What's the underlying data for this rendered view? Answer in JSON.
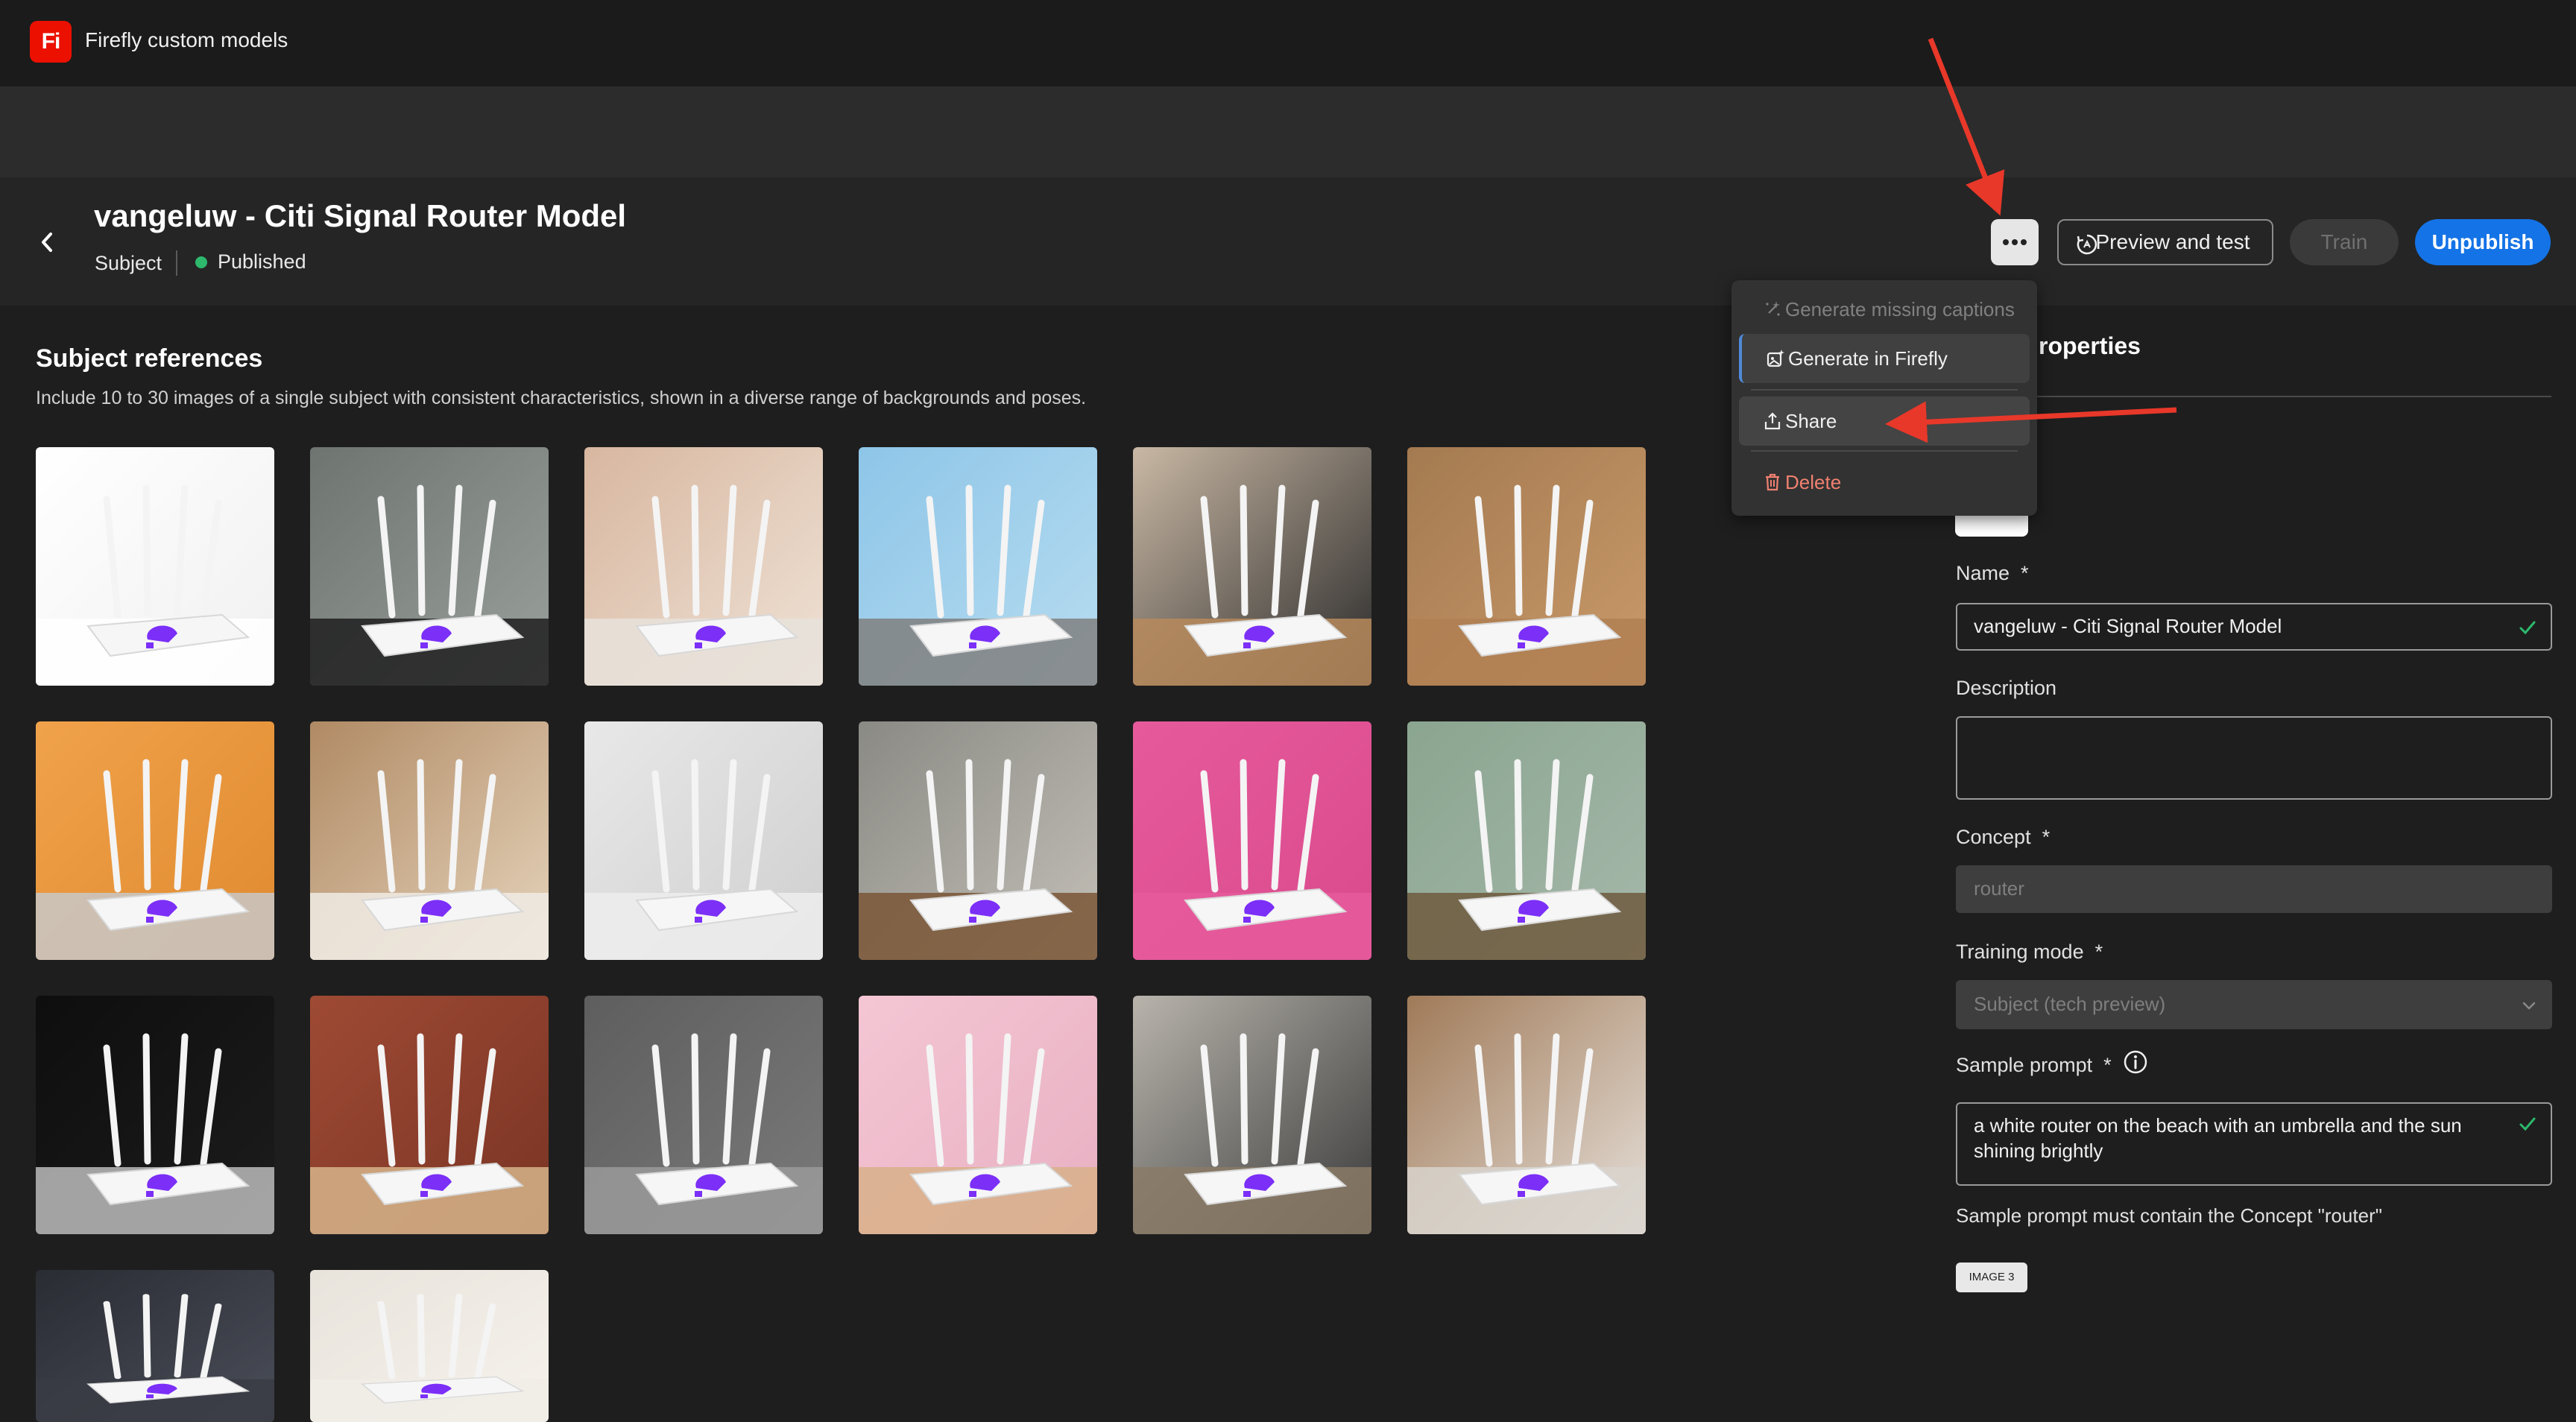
{
  "app": {
    "title": "Firefly custom models",
    "logo_text": "Fi",
    "brand_color": "#eb1000"
  },
  "header": {
    "title": "vangeluw - Citi Signal Router Model",
    "type": "Subject",
    "status": "Published",
    "status_color": "#2db86c",
    "preview_label": "Preview and test",
    "train_label": "Train",
    "unpublish_label": "Unpublish",
    "accent": "#1473e6"
  },
  "references": {
    "title": "Subject references",
    "description": "Include 10 to 30 images of a single subject with consistent characteristics, shown in a diverse range of backgrounds and poses."
  },
  "menu": {
    "items": [
      {
        "label": "Generate missing captions",
        "icon": "sparkle-icon",
        "enabled": false
      },
      {
        "label": "Generate in Firefly",
        "icon": "generate-icon",
        "enabled": true
      },
      {
        "label": "Share",
        "icon": "share-icon",
        "enabled": true
      },
      {
        "label": "Delete",
        "icon": "trash-icon",
        "enabled": true
      }
    ]
  },
  "properties": {
    "heading_visible": "roperties",
    "name_label": "Name",
    "name_value": "vangeluw - Citi Signal Router Model",
    "description_label": "Description",
    "description_value": "",
    "concept_label": "Concept",
    "concept_placeholder": "router",
    "training_mode_label": "Training mode",
    "training_mode_value": "Subject (tech preview)",
    "sample_prompt_label": "Sample prompt",
    "sample_prompt_value": "a white router on the beach with an umbrella and the sun shining brightly",
    "hint": "Sample prompt must contain the Concept \"router\"",
    "tag": "IMAGE 3",
    "required_mark": "*"
  },
  "tiles": [
    {
      "bg1": "#ffffff",
      "bg2": "#f0f0f0",
      "floor": "#ffffff"
    },
    {
      "bg1": "#6e7470",
      "bg2": "#9aa09c",
      "floor": "#1e1e1e"
    },
    {
      "bg1": "#d8b7a0",
      "bg2": "#efe2d6",
      "floor": "#e8e2da"
    },
    {
      "bg1": "#8ec6e8",
      "bg2": "#b7dcf0",
      "floor": "#808080"
    },
    {
      "bg1": "#c9b8a4",
      "bg2": "#2a2a2a",
      "floor": "#b78a5c"
    },
    {
      "bg1": "#a47a50",
      "bg2": "#c99a6a",
      "floor": "#b07f52"
    },
    {
      "bg1": "#f0a24a",
      "bg2": "#e08a30",
      "floor": "#c8c8c8"
    },
    {
      "bg1": "#b08a64",
      "bg2": "#e6d4bc",
      "floor": "#f0ebe4"
    },
    {
      "bg1": "#e8e8e8",
      "bg2": "#cfcfcf",
      "floor": "#ededed"
    },
    {
      "bg1": "#8a8a84",
      "bg2": "#c4c0b8",
      "floor": "#7a5636"
    },
    {
      "bg1": "#e65a9c",
      "bg2": "#d94a8c",
      "floor": "#e65a9c"
    },
    {
      "bg1": "#8aa590",
      "bg2": "#a6b8aa",
      "floor": "#6e5a3e"
    },
    {
      "bg1": "#0e0e0e",
      "bg2": "#1c1c1c",
      "floor": "#bcbcbc"
    },
    {
      "bg1": "#9e4a34",
      "bg2": "#7a3424",
      "floor": "#d6b48a"
    },
    {
      "bg1": "#5e5e5e",
      "bg2": "#7a7a7a",
      "floor": "#9a9a9a"
    },
    {
      "bg1": "#f4c6d4",
      "bg2": "#e8b0c2",
      "floor": "#d8b08a"
    },
    {
      "bg1": "#b8b4ac",
      "bg2": "#3a3a3a",
      "floor": "#8a7a66"
    },
    {
      "bg1": "#a07a58",
      "bg2": "#e6e0da",
      "floor": "#d8d4cc"
    },
    {
      "bg1": "#2a2c34",
      "bg2": "#4a4e58",
      "floor": "#3a3c44"
    },
    {
      "bg1": "#e8e4dc",
      "bg2": "#f6f2ec",
      "floor": "#f0ece6"
    }
  ],
  "colors": {
    "router_logo": "#7b2ff7",
    "annotation_arrow": "#e8382a"
  }
}
